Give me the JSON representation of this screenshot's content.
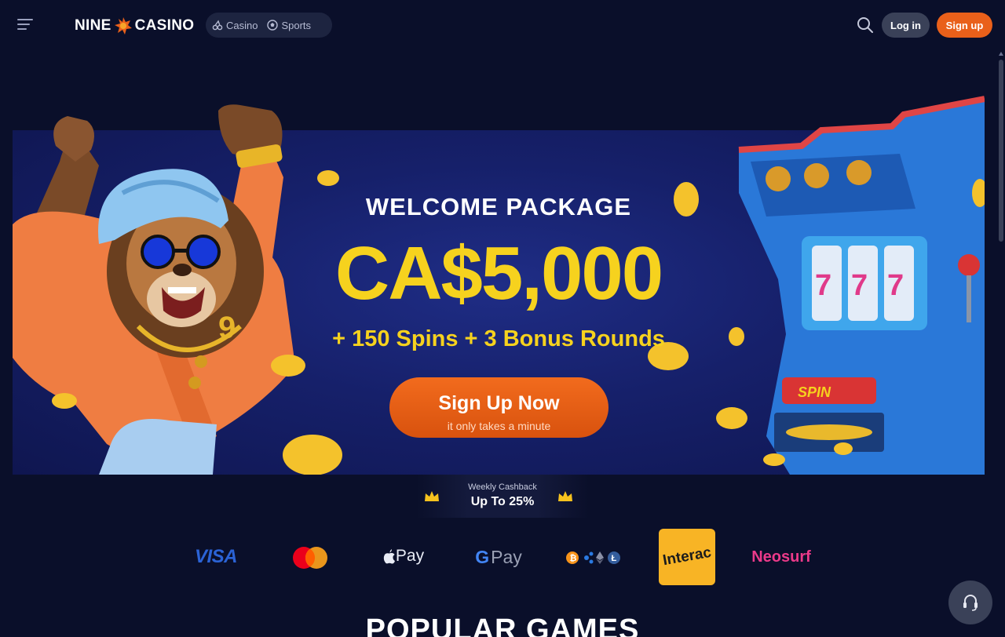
{
  "header": {
    "logo_left": "NINE",
    "logo_right": "CASINO",
    "nav": [
      {
        "label": "Casino",
        "icon": "cherries-icon"
      },
      {
        "label": "Sports",
        "icon": "soccer-ball-icon"
      }
    ],
    "login_label": "Log in",
    "signup_label": "Sign up"
  },
  "banner": {
    "title": "WELCOME PACKAGE",
    "amount": "CA$5,000",
    "bonus": "+ 150 Spins + 3 Bonus Rounds",
    "cta_label": "Sign Up Now",
    "cta_sub": "it only takes a minute",
    "slot_button": "SPIN"
  },
  "cashback": {
    "label": "Weekly Cashback",
    "value": "Up To 25%"
  },
  "payments": {
    "visa": "VISA",
    "applepay": "Pay",
    "gpay_g": "G",
    "gpay": "Pay",
    "interac": "Interac",
    "neosurf": "Neosurf"
  },
  "section_title": "POPULAR GAMES",
  "colors": {
    "background": "#0a0f2a",
    "accent": "#e9601a",
    "gold": "#f6d21e"
  }
}
